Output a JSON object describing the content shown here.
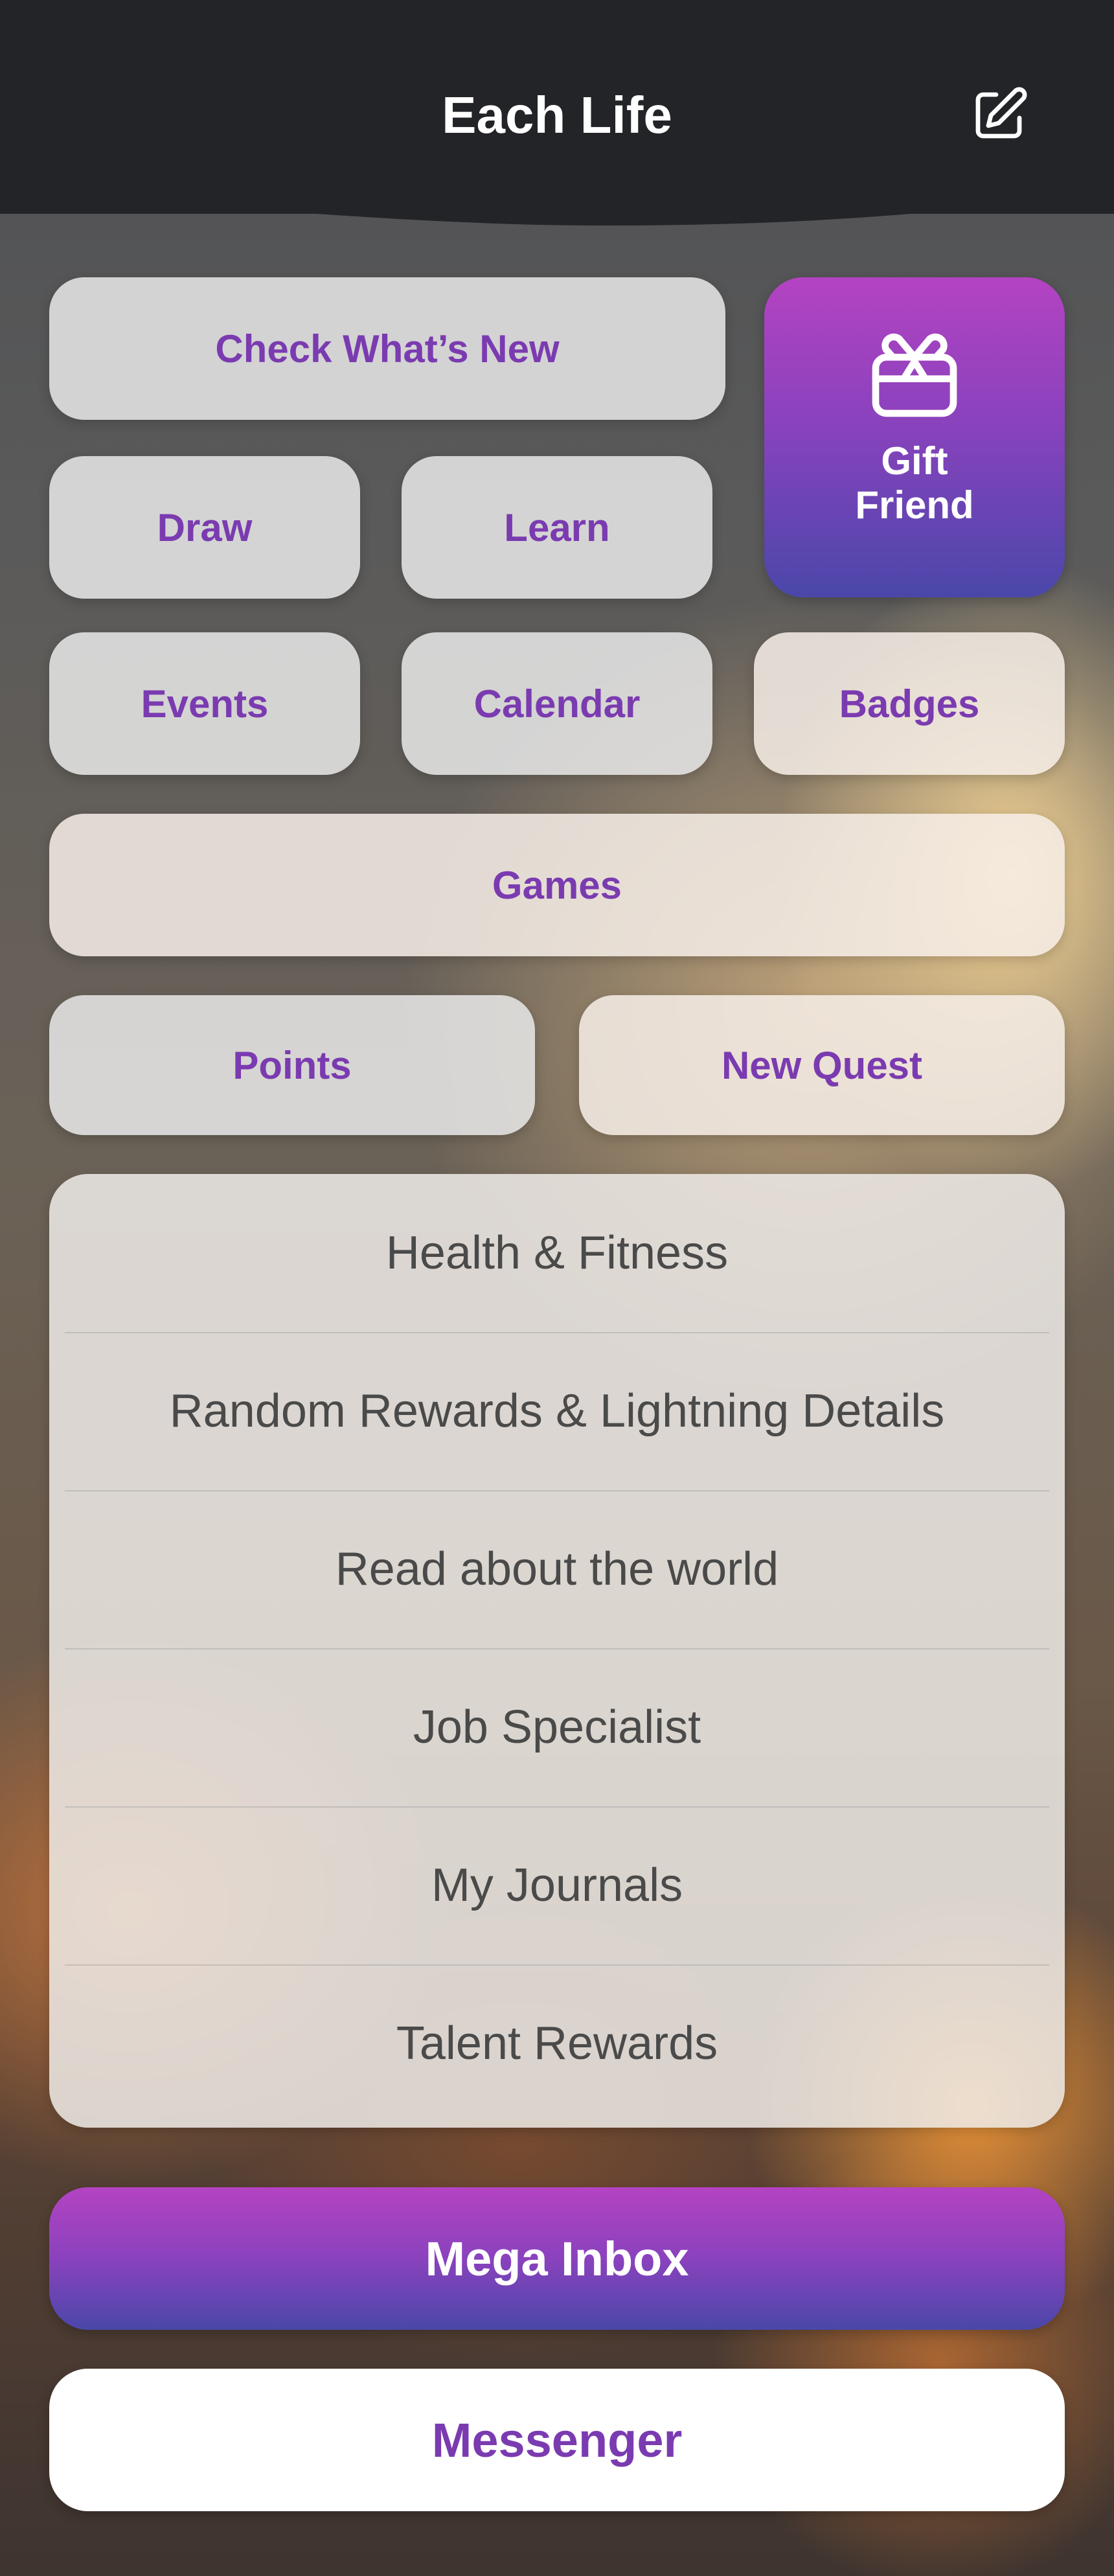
{
  "header": {
    "title": "Each Life",
    "edit_icon": "edit-icon"
  },
  "grid": {
    "check_whats_new": "Check What’s New",
    "gift_friend": "Gift Friend",
    "gift_icon": "gift-icon",
    "draw": "Draw",
    "learn": "Learn",
    "events": "Events",
    "calendar": "Calendar",
    "badges": "Badges",
    "games": "Games",
    "points": "Points",
    "new_quest": "New Quest"
  },
  "list": {
    "items": [
      {
        "label": "Health & Fitness"
      },
      {
        "label": "Random Rewards & Lightning Details"
      },
      {
        "label": "Read about the world"
      },
      {
        "label": "Job Specialist"
      },
      {
        "label": "My Journals"
      },
      {
        "label": "Talent Rewards"
      }
    ]
  },
  "bottom": {
    "mega_inbox": "Mega Inbox",
    "messenger": "Messenger"
  },
  "colors": {
    "accent_purple": "#7b3bb0",
    "gradient_top": "#b443c2",
    "gradient_bottom": "#4a47a9",
    "header_bg": "#222428"
  }
}
